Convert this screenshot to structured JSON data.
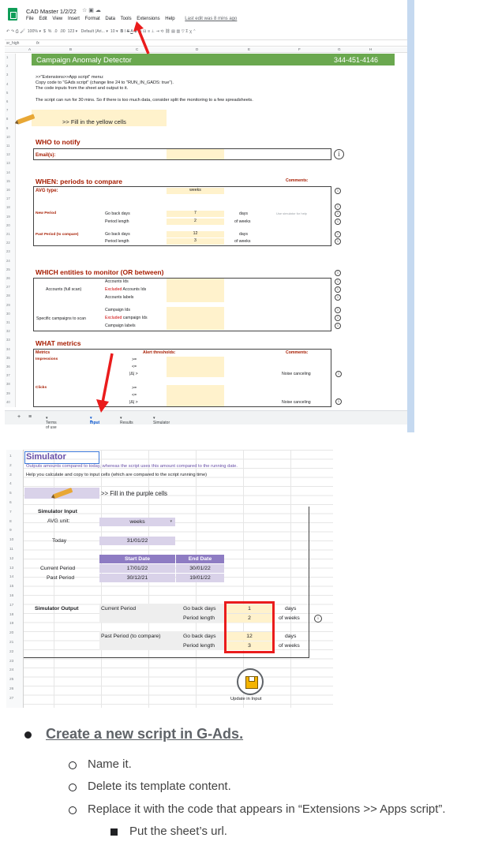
{
  "sheet": {
    "doc_title": "CAD Master 1/2/22",
    "title_icons": [
      "star-icon",
      "move-icon",
      "cloud-icon"
    ],
    "menu": [
      "File",
      "Edit",
      "View",
      "Insert",
      "Format",
      "Data",
      "Tools",
      "Extensions",
      "Help"
    ],
    "last_edit": "Last edit was 8 mins ago",
    "toolbar": {
      "zoom": "100%",
      "currency": "$",
      "percent": "%",
      "dec_minus": ".0",
      "dec_plus": ".00",
      "format_more": "123",
      "font": "Default (Ari...",
      "size": "10"
    },
    "cell_ref": "sr_high",
    "fx": "fx",
    "columns": [
      "A",
      "B",
      "C",
      "D",
      "E",
      "F",
      "G",
      "H"
    ],
    "header_title": "Campaign Anomaly Detector",
    "header_phone": "344-451-4146",
    "instructions": [
      ">>\"Extensions>>App script\" menu:",
      "Copy code to \"GAds script\" (change line 24 to \"RUN_IN_GADS: true\").",
      "The code inputs from the sheet and output to it.",
      "The script can run for 30 mins. So if there is too much data, consider split the monitoring to a few spreadsheets."
    ],
    "fill_yellow": ">> Fill in the yellow cells",
    "who": {
      "title": "WHO to notify",
      "email_label": "Email(s):"
    },
    "when": {
      "title": "WHEN: periods to compare",
      "comments": "Comments:",
      "avg_type_label": "AVG type:",
      "avg_type_value": "weeks",
      "new_period": "New Period",
      "past_period": "Past Period (to compare)",
      "go_back_days": "Go back days",
      "period_length": "Period length",
      "new_go_back": "7",
      "new_length": "2",
      "past_go_back": "12",
      "past_length": "3",
      "days": "days",
      "of_weeks": "of weeks",
      "simulator_hint": "Use simulator for help"
    },
    "which": {
      "title": "WHICH entities to monitor (OR between)",
      "accounts_group": "Accounts (full scan)",
      "campaigns_group": "Specific campaigns to scan",
      "accounts_ids": "Accounts Ids",
      "excluded": "Excluded",
      "accounts_ids_suffix": "Accounts Ids",
      "accounts_labels": "Accounts labels",
      "campaign_ids": "Campaign Ids",
      "campaign_ids_suffix": "campaign Ids",
      "campaign_labels": "Campaign labels"
    },
    "what": {
      "title": "WHAT metrics",
      "metrics": "Metrics",
      "alert": "Alert thresholds:",
      "comments": "Comments:",
      "impressions": "Impressions",
      "clicks": "Clicks",
      "gte": ">=",
      "lte": "<=",
      "delta": "|Δ| >",
      "noise": "Noise canceling"
    },
    "tabs": [
      "Terms of use",
      "Input",
      "Results",
      "Simulator"
    ],
    "active_tab": "Input"
  },
  "simulator": {
    "title": "Simulator",
    "subtitle": "Outputs amounts compared to today, whereas the script uses this amount compared to the running date.",
    "help": "Help you calculate and copy to input cells (which are compared to the script running time)",
    "fill_purple": ">> Fill in the purple cells",
    "input_title": "Simulator Input",
    "avg_unit_label": "AVG unit:",
    "avg_unit_value": "weeks",
    "today_label": "Today",
    "today_value": "31/01/22",
    "start_date": "Start Date",
    "end_date": "End Date",
    "current_period": "Current Period",
    "current_start": "17/01/22",
    "current_end": "30/01/22",
    "past_period": "Past Period",
    "past_start": "30/12/21",
    "past_end": "19/01/22",
    "output_title": "Simulator Output",
    "out_current": "Current Period",
    "out_past": "Past Period (to compare)",
    "go_back_days": "Go back days",
    "period_length": "Period length",
    "cur_go_back": "1",
    "cur_length": "2",
    "past_go_back": "12",
    "past_length": "3",
    "days": "days",
    "of_weeks": "of weeks",
    "update_label": "Update in Input"
  },
  "doc": {
    "heading": "Create a new script in G-Ads.",
    "steps": [
      "Name it.",
      "Delete its template content.",
      "Replace it with the code that appears in “Extensions >> Apps script”."
    ],
    "substep": "Put the sheet’s url."
  },
  "colors": {
    "header_green": "#6aa84f",
    "section_red": "#a61c00",
    "fill_yellow": "#fff2cc",
    "fill_purple": "#d9d2e9",
    "purple_header": "#8e7cc3",
    "annotation_red": "#ea1c1c"
  }
}
